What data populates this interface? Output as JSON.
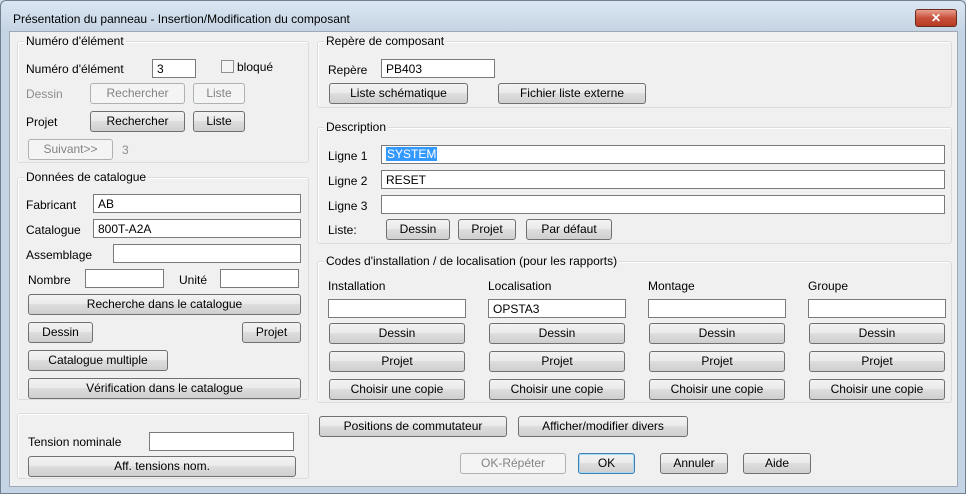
{
  "window": {
    "title": "Présentation du panneau - Insertion/Modification du composant",
    "close_glyph": "✕"
  },
  "element_group": {
    "title": "Numéro d'élément",
    "numero_label": "Numéro d'élément",
    "numero_value": "3",
    "bloque_label": "bloqué",
    "dessin_label": "Dessin",
    "projet_label": "Projet",
    "rechercher_label": "Rechercher",
    "liste_label": "Liste",
    "suivant_label": "Suivant>>",
    "suivant_value": "3"
  },
  "catalog_group": {
    "title": "Données de catalogue",
    "fabricant_label": "Fabricant",
    "fabricant_value": "AB",
    "catalogue_label": "Catalogue",
    "catalogue_value": "800T-A2A",
    "assemblage_label": "Assemblage",
    "assemblage_value": "",
    "nombre_label": "Nombre",
    "nombre_value": "",
    "unite_label": "Unité",
    "unite_value": "",
    "recherche_catalogue_label": "Recherche dans le catalogue",
    "dessin_label": "Dessin",
    "projet_label": "Projet",
    "catalogue_multiple_label": "Catalogue multiple",
    "verification_label": "Vérification dans le catalogue"
  },
  "tension_group": {
    "label": "Tension nominale",
    "value": "",
    "button_label": "Aff. tensions nom."
  },
  "repere_group": {
    "title": "Repère de composant",
    "repere_label": "Repère",
    "repere_value": "PB403",
    "liste_schematique_label": "Liste schématique",
    "fichier_liste_label": "Fichier liste externe"
  },
  "description_group": {
    "title": "Description",
    "ligne1_label": "Ligne 1",
    "ligne1_value": "SYSTEM",
    "ligne2_label": "Ligne 2",
    "ligne2_value": "RESET",
    "ligne3_label": "Ligne 3",
    "ligne3_value": "",
    "liste_label": "Liste:",
    "dessin_label": "Dessin",
    "projet_label": "Projet",
    "par_defaut_label": "Par défaut"
  },
  "codes_group": {
    "title": "Codes d'installation / de localisation  (pour les rapports)",
    "columns": [
      {
        "label": "Installation",
        "value": ""
      },
      {
        "label": "Localisation",
        "value": "OPSTA3"
      },
      {
        "label": "Montage",
        "value": ""
      },
      {
        "label": "Groupe",
        "value": ""
      }
    ],
    "dessin_label": "Dessin",
    "projet_label": "Projet",
    "choisir_label": "Choisir une copie"
  },
  "bottom": {
    "positions_label": "Positions de commutateur",
    "afficher_label": "Afficher/modifier divers",
    "ok_repeter_label": "OK-Répéter",
    "ok_label": "OK",
    "annuler_label": "Annuler",
    "aide_label": "Aide"
  }
}
